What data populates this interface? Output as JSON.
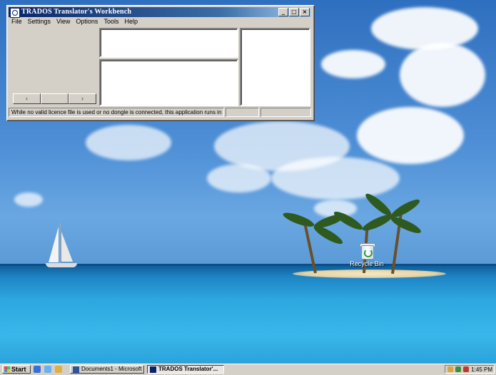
{
  "window": {
    "title": "TRADOS Translator's Workbench",
    "controls": {
      "minimize": "_",
      "maximize": "□",
      "close": "×"
    },
    "menu": [
      "File",
      "Settings",
      "View",
      "Options",
      "Tools",
      "Help"
    ],
    "nav_buttons": [
      "‹",
      "",
      "›"
    ],
    "status": {
      "message": "While no valid licence file is used or no dongle is connected, this application runs in demo",
      "cell2": "",
      "cell3": ""
    }
  },
  "desktop": {
    "recycle_bin_label": "Recycle Bin"
  },
  "taskbar": {
    "start_label": "Start",
    "tasks": [
      {
        "label": "Documents1 - Microsoft ...",
        "active": false
      },
      {
        "label": "TRADOS Translator'...",
        "active": true
      }
    ],
    "clock": "1:45 PM"
  },
  "colors": {
    "titlebar": "#0a246a",
    "window_face": "#d4d0c8",
    "sky": "#4e8fd6",
    "sea": "#2ea7e0"
  }
}
